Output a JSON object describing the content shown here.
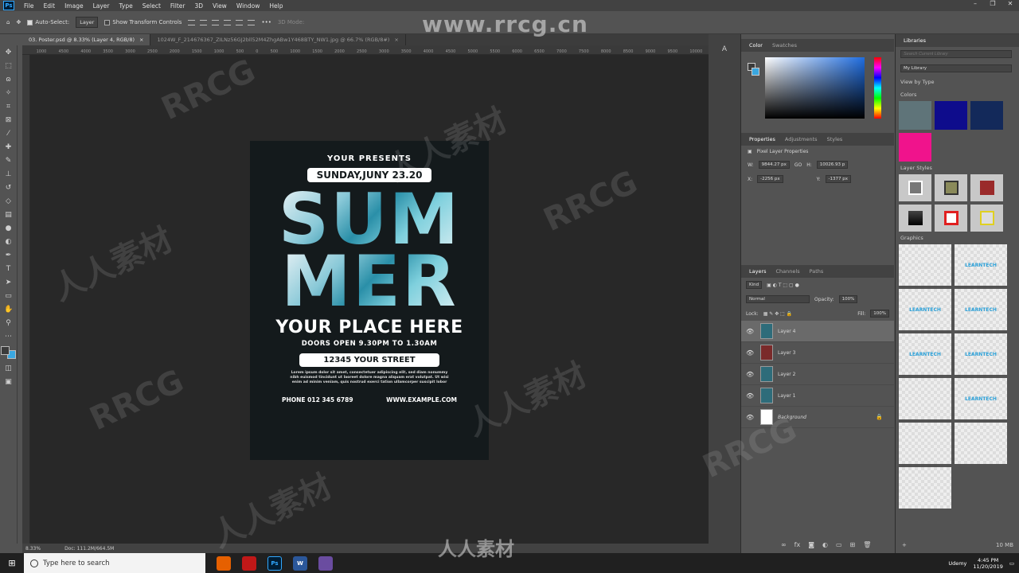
{
  "menubar": {
    "app_icon": "Ps",
    "items": [
      "File",
      "Edit",
      "Image",
      "Layer",
      "Type",
      "Select",
      "Filter",
      "3D",
      "View",
      "Window",
      "Help"
    ]
  },
  "options": {
    "auto_select": "Auto-Select:",
    "auto_select_target": "Layer",
    "transform_controls": "Show Transform Controls",
    "mode_3d": "3D Mode:"
  },
  "doc_tabs": [
    {
      "label": "03. Poster.psd @ 8.33% (Layer 4, RGB/8)",
      "close": "×"
    },
    {
      "label": "1024W_F_214676367_ZILNz56GJ2bll52M4ZhgABw1Y468BTY_NW1.jpg @ 66.7% (RGB/8#)",
      "close": "×"
    }
  ],
  "ruler_ticks": [
    "1000",
    "4500",
    "4000",
    "3500",
    "3000",
    "2500",
    "2000",
    "1500",
    "1000",
    "500",
    "0",
    "500",
    "1000",
    "1500",
    "2000",
    "2500",
    "3000",
    "3500",
    "4000",
    "4500",
    "5000",
    "5500",
    "6000",
    "6500",
    "7000",
    "7500",
    "8000",
    "8500",
    "9000",
    "9500",
    "10000"
  ],
  "poster": {
    "presents": "YOUR PRESENTS",
    "date": "SUNDAY,JUNY 23.20",
    "word1": "SUM",
    "word2": "MER",
    "place": "YOUR PLACE HERE",
    "doors": "DOORS OPEN 9.30PM TO 1.30AM",
    "street": "12345 YOUR STREET",
    "lorem": "Lorem ipsum dolor sit amet, consectetuer adipiscing elit, sed diam nonummy nibh euismod tincidunt ut laoreet dolore magna aliquam erat volutpat. Ut wisi enim ad minim veniam, quis nostrud exerci tation ullamcorper suscipit lobor",
    "phone": "PHONE 012 345 6789",
    "web": "WWW.EXAMPLE.COM"
  },
  "statusbar": {
    "zoom": "8.33%",
    "doc": "Doc: 111.2M/664.5M"
  },
  "color_panel": {
    "tabs": [
      "Color",
      "Swatches"
    ]
  },
  "properties_panel": {
    "tabs": [
      "Properties",
      "Adjustments",
      "Styles"
    ],
    "title": "Pixel Layer Properties",
    "w_label": "W:",
    "w": "9844.27 px",
    "h_label": "H:",
    "h": "10026.93 p",
    "x_label": "X:",
    "x": "-2256 px",
    "y_label": "Y:",
    "y": "-1377 px",
    "link": "GO"
  },
  "layers_panel": {
    "tabs": [
      "Layers",
      "Channels",
      "Paths"
    ],
    "kind": "Kind",
    "blend": "Normal",
    "opacity_label": "Opacity:",
    "opacity": "100%",
    "lock_label": "Lock:",
    "fill_label": "Fill:",
    "fill": "100%",
    "layers": [
      {
        "name": "Layer 4",
        "selected": true
      },
      {
        "name": "Layer 3",
        "selected": false
      },
      {
        "name": "Layer 2",
        "selected": false
      },
      {
        "name": "Layer 1",
        "selected": false
      },
      {
        "name": "Background",
        "selected": false
      }
    ]
  },
  "libraries": {
    "title": "Libraries",
    "search_placeholder": "Search Current Library",
    "library": "My Library",
    "view": "View by Type",
    "colors_label": "Colors",
    "colors": [
      "#5f7479",
      "#0e0c8c",
      "#13295a",
      "#f0138c"
    ],
    "styles_label": "Layer Styles",
    "graphics_label": "Graphics",
    "graphic_text": "LEARNTECH",
    "size": "10 MB"
  },
  "taskbar": {
    "search_placeholder": "Type here to search",
    "time": "4:45 PM",
    "date": "11/20/2019",
    "udemy": "Udemy"
  },
  "watermarks": {
    "url": "www.rrcg.cn",
    "bottom": "人人素材",
    "rrcg": "RRCG",
    "cn": "人人素材"
  }
}
